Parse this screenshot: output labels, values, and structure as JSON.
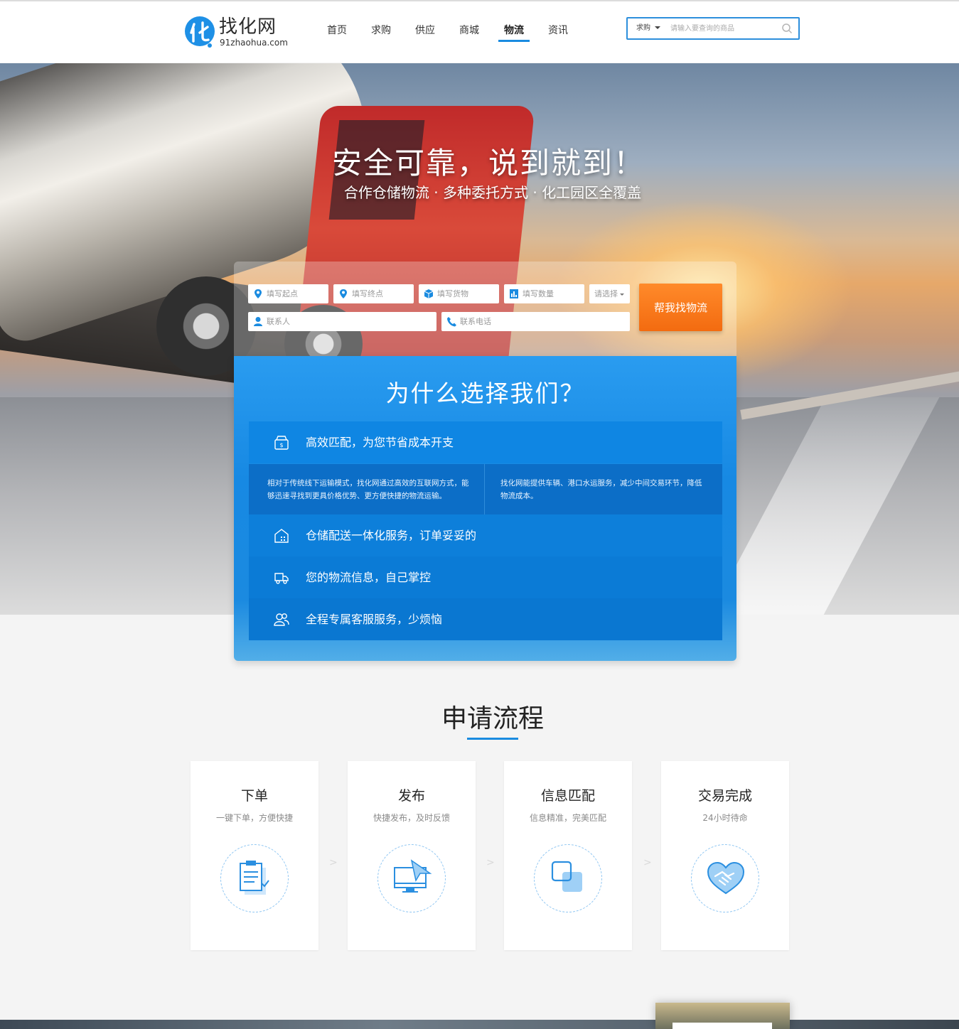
{
  "header": {
    "logo_name": "找化网",
    "logo_domain": "91zhaohua.com",
    "nav": [
      {
        "label": "首页",
        "active": false
      },
      {
        "label": "求购",
        "active": false
      },
      {
        "label": "供应",
        "active": false
      },
      {
        "label": "商城",
        "active": false
      },
      {
        "label": "物流",
        "active": true
      },
      {
        "label": "资讯",
        "active": false
      }
    ],
    "search": {
      "type_selected": "求购",
      "placeholder": "请输入要查询的商品",
      "accent_color": "#2d8fdc"
    }
  },
  "hero": {
    "title": "安全可靠，说到就到！",
    "subtitle": "合作仓储物流 · 多种委托方式 · 化工园区全覆盖"
  },
  "form": {
    "origin_placeholder": "填写起点",
    "destination_placeholder": "填写终点",
    "cargo_placeholder": "填写货物",
    "quantity_placeholder": "填写数量",
    "unit_select": "请选择",
    "contact_placeholder": "联系人",
    "phone_placeholder": "联系电话",
    "submit_label": "帮我找物流",
    "submit_color": "#f36b10"
  },
  "why": {
    "title": "为什么选择我们？",
    "items": [
      {
        "label": "高效匹配，为您节省成本开支",
        "icon": "wallet-icon"
      },
      {
        "label": "仓储配送一体化服务，订单妥妥的",
        "icon": "warehouse-icon"
      },
      {
        "label": "您的物流信息，自己掌控",
        "icon": "truck-icon"
      },
      {
        "label": "全程专属客服服务，少烦恼",
        "icon": "users-icon"
      }
    ],
    "detail": [
      "相对于传统线下运输模式，找化网通过高效的互联网方式，能够迅速寻找到更具价格优势、更方便快捷的物流运输。",
      "找化网能提供车辆、港口水运服务，减少中间交易环节，降低物流成本。"
    ]
  },
  "process": {
    "title": "申请流程",
    "steps": [
      {
        "name": "下单",
        "desc": "一键下单，方便快捷",
        "icon": "clipboard-icon"
      },
      {
        "name": "发布",
        "desc": "快捷发布，及时反馈",
        "icon": "monitor-send-icon"
      },
      {
        "name": "信息匹配",
        "desc": "信息精准，完美匹配",
        "icon": "match-squares-icon"
      },
      {
        "name": "交易完成",
        "desc": "24小时待命",
        "icon": "handshake-icon"
      }
    ],
    "separator": ">"
  },
  "colors": {
    "brand_blue": "#1a8be0",
    "orange": "#f36b10"
  }
}
